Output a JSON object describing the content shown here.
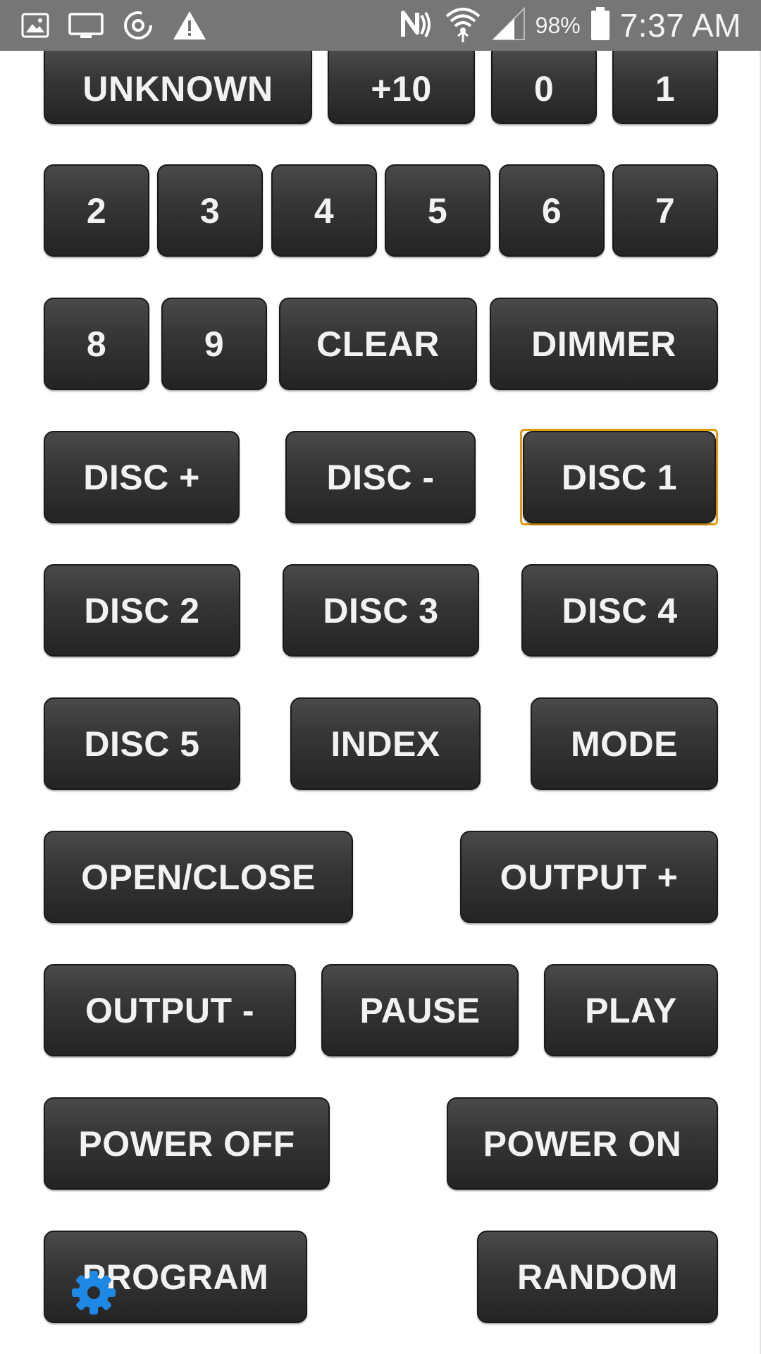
{
  "status_bar": {
    "battery_percent": "98%",
    "time": "7:37 AM",
    "left_icons": [
      "gallery-icon",
      "cast-screen-icon",
      "sync-icon",
      "warning-icon"
    ],
    "right_icons": [
      "nfc-icon",
      "wifi-icon",
      "signal-icon",
      "battery-icon"
    ]
  },
  "remote": {
    "buttons": [
      "UNKNOWN",
      "+10",
      "0",
      "1",
      "2",
      "3",
      "4",
      "5",
      "6",
      "7",
      "8",
      "9",
      "CLEAR",
      "DIMMER",
      "DISC +",
      "DISC -",
      "DISC 1",
      "DISC 2",
      "DISC 3",
      "DISC 4",
      "DISC 5",
      "INDEX",
      "MODE",
      "OPEN/CLOSE",
      "OUTPUT +",
      "OUTPUT -",
      "PAUSE",
      "PLAY",
      "POWER OFF",
      "POWER ON",
      "PROGRAM",
      "RANDOM"
    ],
    "focused_button": "DISC 1"
  },
  "colors": {
    "status_bar": "#767676",
    "button_top": "#4a4a4a",
    "button_bottom": "#242424",
    "focus_ring": "#e39c10",
    "settings_fab": "#1e88e5"
  },
  "settings_icon": "gear-icon"
}
